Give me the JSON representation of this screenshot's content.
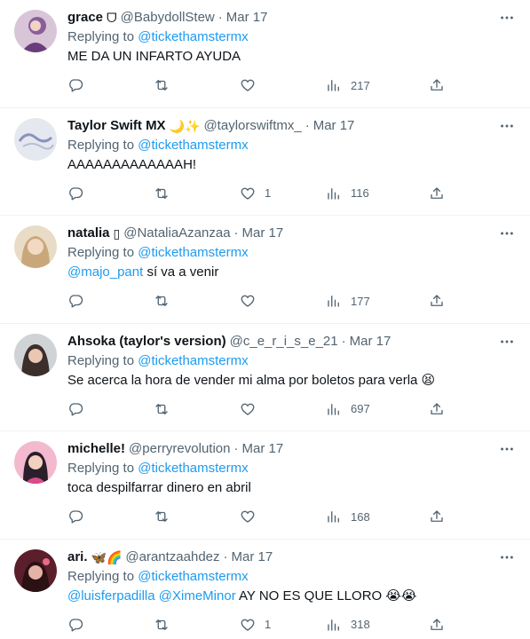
{
  "colors": {
    "accent": "#1d9bf0",
    "text": "#0f1419",
    "muted": "#536471",
    "divider": "#eff3f4"
  },
  "icons": {
    "reply": "reply-icon",
    "retweet": "retweet-icon",
    "like": "heart-icon",
    "views": "views-icon",
    "share": "share-icon",
    "more": "more-icon"
  },
  "tweets": [
    {
      "name": "grace",
      "emoji": "ᗜ",
      "handle": "@BabydollStew",
      "time": "Mar 17",
      "replying_prefix": "Replying to",
      "replying_to": "@tickethamstermx",
      "text": "ME DA UN INFARTO AYUDA",
      "likes": "",
      "views": "217",
      "avatar_color": "#8b5e9b"
    },
    {
      "name": "Taylor Swift MX",
      "emoji": "🌙✨",
      "handle": "@taylorswiftmx_",
      "time": "Mar 17",
      "replying_prefix": "Replying to",
      "replying_to": "@tickethamstermx",
      "text": "AAAAAAAAAAAAAH!",
      "likes": "1",
      "views": "116",
      "avatar_color": "#c9cfe0"
    },
    {
      "name": "natalia",
      "emoji": "▯",
      "handle": "@NataliaAzanzaa",
      "time": "Mar 17",
      "replying_prefix": "Replying to",
      "replying_to": "@tickethamstermx",
      "text_mention": "@majo_pant",
      "text": " sí va a venir",
      "likes": "",
      "views": "177",
      "avatar_color": "#b89a72"
    },
    {
      "name": "Ahsoka (taylor's version)",
      "emoji": "",
      "handle": "@c_e_r_i_s_e_21",
      "time": "Mar 17",
      "replying_prefix": "Replying to",
      "replying_to": "@tickethamstermx",
      "text": "Se acerca la hora de vender mi alma por boletos para verla 😫",
      "likes": "",
      "views": "697",
      "avatar_color": "#5b4a44"
    },
    {
      "name": "michelle!",
      "emoji": "",
      "handle": "@perryrevolution",
      "time": "Mar 17",
      "replying_prefix": "Replying to",
      "replying_to": "@tickethamstermx",
      "text": "toca despilfarrar dinero en abril",
      "likes": "",
      "views": "168",
      "avatar_color": "#d94c8a"
    },
    {
      "name": "ari.",
      "emoji": "🦋🌈",
      "handle": "@arantzaahdez",
      "time": "Mar 17",
      "replying_prefix": "Replying to",
      "replying_to": "@tickethamstermx",
      "text_mention": "@luisferpadilla @XimeMinor",
      "text": "  AY NO ES QUE LLORO 😭😭",
      "likes": "1",
      "views": "318",
      "avatar_color": "#a03a4a"
    }
  ]
}
